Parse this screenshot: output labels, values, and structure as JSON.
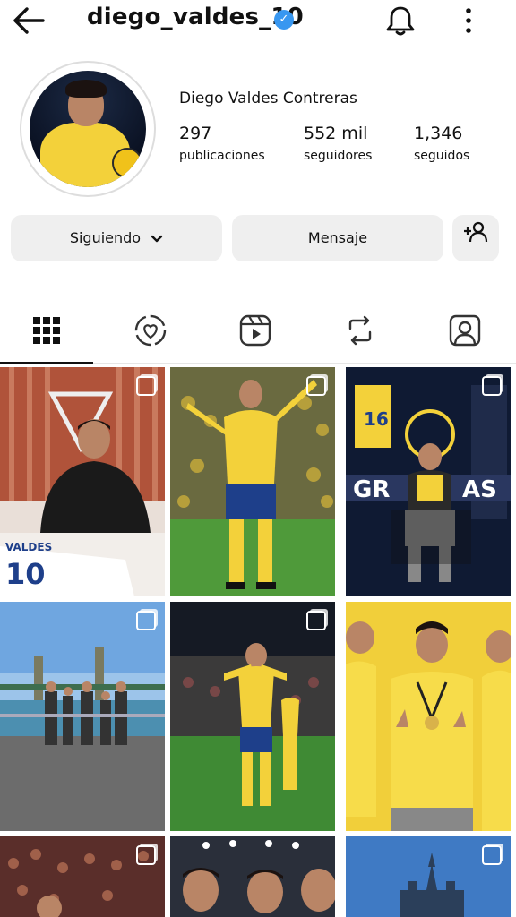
{
  "header": {
    "username": "diego_valdes_10",
    "verified_icon": "verified-badge-icon",
    "back_icon": "arrow-left-icon",
    "bell_icon": "bell-icon",
    "more_icon": "more-vertical-icon"
  },
  "profile": {
    "full_name": "Diego Valdes Contreras",
    "posts_count": "297",
    "posts_label": "publicaciones",
    "followers_count": "552 mil",
    "followers_label": "seguidores",
    "following_count": "1,346",
    "following_label": "seguidos"
  },
  "actions": {
    "following_label": "Siguiendo",
    "message_label": "Mensaje",
    "add_user_icon": "person-add-icon"
  },
  "tabs": [
    {
      "icon": "grid-icon",
      "active": true
    },
    {
      "icon": "heart-circle-icon",
      "active": false
    },
    {
      "icon": "reels-icon",
      "active": false
    },
    {
      "icon": "reposts-icon",
      "active": false
    },
    {
      "icon": "tagged-icon",
      "active": false
    }
  ],
  "posts": [
    {
      "alt": "signing",
      "multi": true
    },
    {
      "alt": "celebration",
      "multi": true
    },
    {
      "alt": "gracias",
      "multi": true
    },
    {
      "alt": "family bridge",
      "multi": true
    },
    {
      "alt": "night match",
      "multi": true
    },
    {
      "alt": "team medals",
      "multi": false
    },
    {
      "alt": "crowd",
      "multi": true
    },
    {
      "alt": "team selfie",
      "multi": false
    },
    {
      "alt": "castle",
      "multi": true
    }
  ],
  "colors": {
    "verified": "#3897f0",
    "button_bg": "#efefef",
    "club_yellow": "#f3d13a"
  }
}
